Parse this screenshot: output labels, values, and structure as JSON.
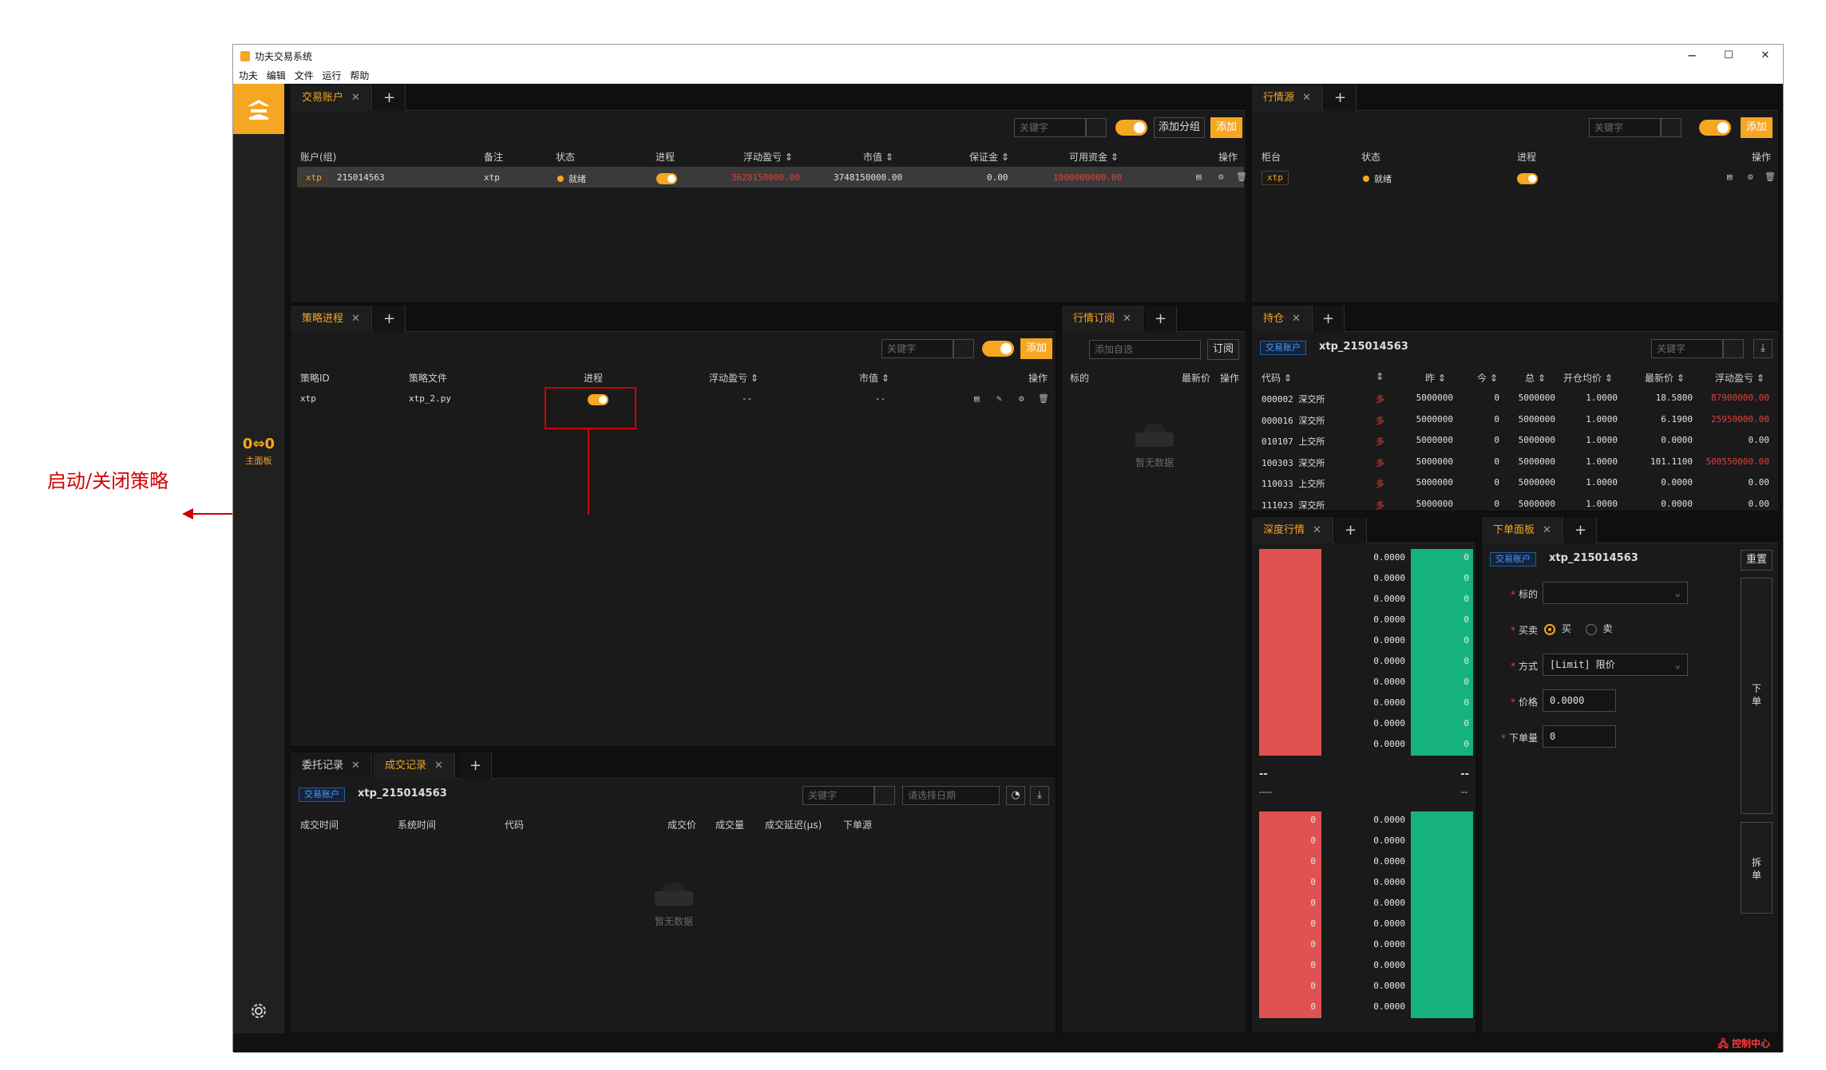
{
  "window": {
    "title": "功夫交易系统",
    "minimize": "─",
    "maximize": "☐",
    "close": "✕"
  },
  "menu": [
    "功夫",
    "编辑",
    "文件",
    "运行",
    "帮助"
  ],
  "sidebar": {
    "main_label": "主面板",
    "main_glyph": "0⇔0"
  },
  "status": {
    "control_center": "🖧 控制中心"
  },
  "account_panel": {
    "tab": "交易账户",
    "search_placeholder": "关键字",
    "add_group": "添加分组",
    "add": "添加",
    "columns": [
      "账户(组)",
      "备注",
      "状态",
      "进程",
      "浮动盈亏 ⇕",
      "市值 ⇕",
      "保证金 ⇕",
      "可用资金 ⇕",
      "操作"
    ],
    "row": {
      "tag": "xtp",
      "id": "215014563",
      "note": "xtp",
      "status": "就绪",
      "pnl": "3628150000.00",
      "market_value": "3748150000.00",
      "margin": "0.00",
      "available": "1000000000.00"
    }
  },
  "md_source_panel": {
    "tab": "行情源",
    "search_placeholder": "关键字",
    "add": "添加",
    "columns": [
      "柜台",
      "状态",
      "进程",
      "操作"
    ],
    "row": {
      "tag": "xtp",
      "status": "就绪"
    }
  },
  "strategy_panel": {
    "tab": "策略进程",
    "search_placeholder": "关键字",
    "add": "添加",
    "columns": [
      "策略ID",
      "策略文件",
      "进程",
      "浮动盈亏 ⇕",
      "市值 ⇕",
      "操作"
    ],
    "row": {
      "id": "xtp",
      "file": "xtp_2.py",
      "pnl": "--",
      "market_value": "--"
    }
  },
  "subscription_panel": {
    "tab": "行情订阅",
    "add_placeholder": "添加自选",
    "subscribe": "订阅",
    "columns": [
      "标的",
      "最新价",
      "操作"
    ],
    "empty": "暂无数据"
  },
  "position_panel": {
    "tab": "持仓",
    "account_tag": "交易账户",
    "account": "xtp_215014563",
    "search_placeholder": "关键字",
    "columns": [
      "代码 ⇕",
      "⇕",
      "昨 ⇕",
      "今 ⇕",
      "总 ⇕",
      "开仓均价 ⇕",
      "最新价 ⇕",
      "浮动盈亏 ⇕"
    ],
    "rows": [
      {
        "code": "000002 深交所",
        "dir": "多",
        "yd": "5000000",
        "td": "0",
        "total": "5000000",
        "avg": "1.0000",
        "last": "18.5800",
        "pnl": "87900000.00",
        "neg": true
      },
      {
        "code": "000016 深交所",
        "dir": "多",
        "yd": "5000000",
        "td": "0",
        "total": "5000000",
        "avg": "1.0000",
        "last": "6.1900",
        "pnl": "25950000.00",
        "neg": true
      },
      {
        "code": "010107 上交所",
        "dir": "多",
        "yd": "5000000",
        "td": "0",
        "total": "5000000",
        "avg": "1.0000",
        "last": "0.0000",
        "pnl": "0.00",
        "neg": false
      },
      {
        "code": "100303 深交所",
        "dir": "多",
        "yd": "5000000",
        "td": "0",
        "total": "5000000",
        "avg": "1.0000",
        "last": "101.1100",
        "pnl": "500550000.00",
        "neg": true
      },
      {
        "code": "110033 上交所",
        "dir": "多",
        "yd": "5000000",
        "td": "0",
        "total": "5000000",
        "avg": "1.0000",
        "last": "0.0000",
        "pnl": "0.00",
        "neg": false
      },
      {
        "code": "111023 深交所",
        "dir": "多",
        "yd": "5000000",
        "td": "0",
        "total": "5000000",
        "avg": "1.0000",
        "last": "0.0000",
        "pnl": "0.00",
        "neg": false
      }
    ]
  },
  "orders_panel": {
    "tab_orders": "委托记录",
    "tab_trades": "成交记录",
    "account_tag": "交易账户",
    "account": "xtp_215014563",
    "search_placeholder": "关键字",
    "date_placeholder": "请选择日期",
    "columns": [
      "成交时间",
      "系统时间",
      "代码",
      "成交价",
      "成交量",
      "成交延迟(μs)",
      "下单源"
    ],
    "empty": "暂无数据"
  },
  "depth_panel": {
    "tab": "深度行情",
    "price": "0.0000",
    "vol": "0",
    "mid_left": "--",
    "mid_right": "--",
    "mid_left2": "----",
    "mid_right2": "--"
  },
  "order_form": {
    "tab": "下单面板",
    "account_tag": "交易账户",
    "account": "xtp_215014563",
    "reset": "重置",
    "label_symbol": "标的",
    "label_side": "买卖",
    "buy": "买",
    "sell": "卖",
    "label_type": "方式",
    "type_value": "[Limit] 限价",
    "label_price": "价格",
    "price_value": "0.0000",
    "label_qty": "下单量",
    "qty_value": "0",
    "submit": "下单",
    "split": "拆单"
  },
  "annotation": {
    "text": "启动/关闭策略"
  },
  "colors": {
    "accent": "#f5a623",
    "ask": "#e05252",
    "bid": "#16b27c",
    "negative": "#e0413a",
    "annotation": "#d40000"
  }
}
